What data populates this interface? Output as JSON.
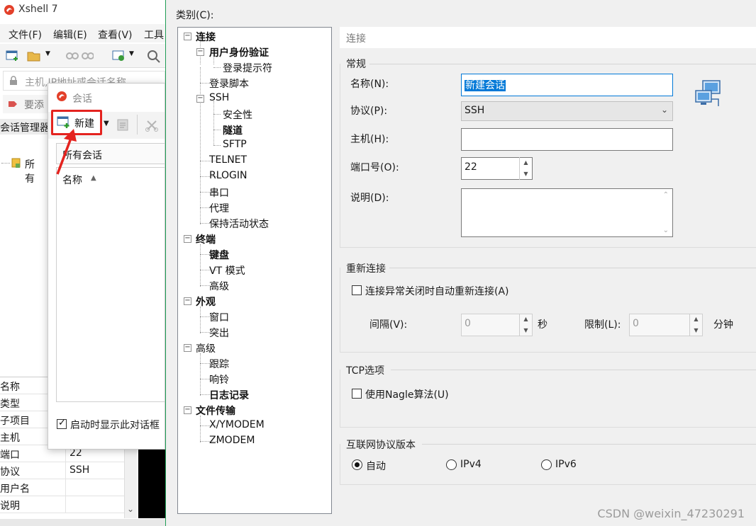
{
  "xshell": {
    "title": "Xshell 7",
    "menu": [
      "文件(F)",
      "编辑(E)",
      "查看(V)",
      "工具"
    ],
    "address_placeholder": "主机,IP地址或会话名称",
    "add_link": "要添",
    "session_manager": "会话管理器",
    "tree_root": "所有",
    "properties": [
      {
        "key": "名称",
        "value": ""
      },
      {
        "key": "类型",
        "value": ""
      },
      {
        "key": "子项目",
        "value": ""
      },
      {
        "key": "主机",
        "value": ""
      },
      {
        "key": "端口",
        "value": "22"
      },
      {
        "key": "协议",
        "value": "SSH"
      },
      {
        "key": "用户名",
        "value": ""
      },
      {
        "key": "说明",
        "value": ""
      }
    ]
  },
  "sessions_dialog": {
    "title": "会话",
    "new_button": "新建",
    "path": "所有会话",
    "list_header": "名称",
    "startup_checkbox": "启动时显示此对话框",
    "startup_checked": true
  },
  "properties_dialog": {
    "category_label": "类别(C):",
    "tree": [
      {
        "label": "连接",
        "bold": true
      },
      {
        "label": "用户身份验证",
        "bold": true
      },
      {
        "label": "登录提示符",
        "bold": false
      },
      {
        "label": "登录脚本",
        "bold": false
      },
      {
        "label": "SSH",
        "bold": false
      },
      {
        "label": "安全性",
        "bold": false
      },
      {
        "label": "隧道",
        "bold": true
      },
      {
        "label": "SFTP",
        "bold": false
      },
      {
        "label": "TELNET",
        "bold": false
      },
      {
        "label": "RLOGIN",
        "bold": false
      },
      {
        "label": "串口",
        "bold": false
      },
      {
        "label": "代理",
        "bold": false
      },
      {
        "label": "保持活动状态",
        "bold": false
      },
      {
        "label": "终端",
        "bold": true
      },
      {
        "label": "键盘",
        "bold": true
      },
      {
        "label": "VT 模式",
        "bold": false
      },
      {
        "label": "高级",
        "bold": false
      },
      {
        "label": "外观",
        "bold": true
      },
      {
        "label": "窗口",
        "bold": false
      },
      {
        "label": "突出",
        "bold": false
      },
      {
        "label": "高级",
        "bold": false
      },
      {
        "label": "跟踪",
        "bold": false
      },
      {
        "label": "响铃",
        "bold": false
      },
      {
        "label": "日志记录",
        "bold": true
      },
      {
        "label": "文件传输",
        "bold": true
      },
      {
        "label": "X/YMODEM",
        "bold": false
      },
      {
        "label": "ZMODEM",
        "bold": false
      }
    ],
    "pane_header": "连接",
    "general": {
      "title": "常规",
      "name_label": "名称(N):",
      "name_value": "新建会话",
      "protocol_label": "协议(P):",
      "protocol_value": "SSH",
      "host_label": "主机(H):",
      "host_value": "",
      "port_label": "端口号(O):",
      "port_value": "22",
      "desc_label": "说明(D):",
      "desc_value": ""
    },
    "reconnect": {
      "title": "重新连接",
      "checkbox": "连接异常关闭时自动重新连接(A)",
      "checked": false,
      "interval_label": "间隔(V):",
      "interval_value": "0",
      "interval_unit": "秒",
      "limit_label": "限制(L):",
      "limit_value": "0",
      "limit_unit": "分钟"
    },
    "tcp": {
      "title": "TCP选项",
      "checkbox": "使用Nagle算法(U)",
      "checked": false
    },
    "ip_version": {
      "title": "互联网协议版本",
      "options": [
        "自动",
        "IPv4",
        "IPv6"
      ],
      "selected": "自动"
    }
  },
  "watermark": "CSDN @weixin_47230291",
  "colors": {
    "highlight_red": "#e4231f",
    "selection_blue": "#0078d7",
    "window_border_green": "#1f9d55"
  }
}
